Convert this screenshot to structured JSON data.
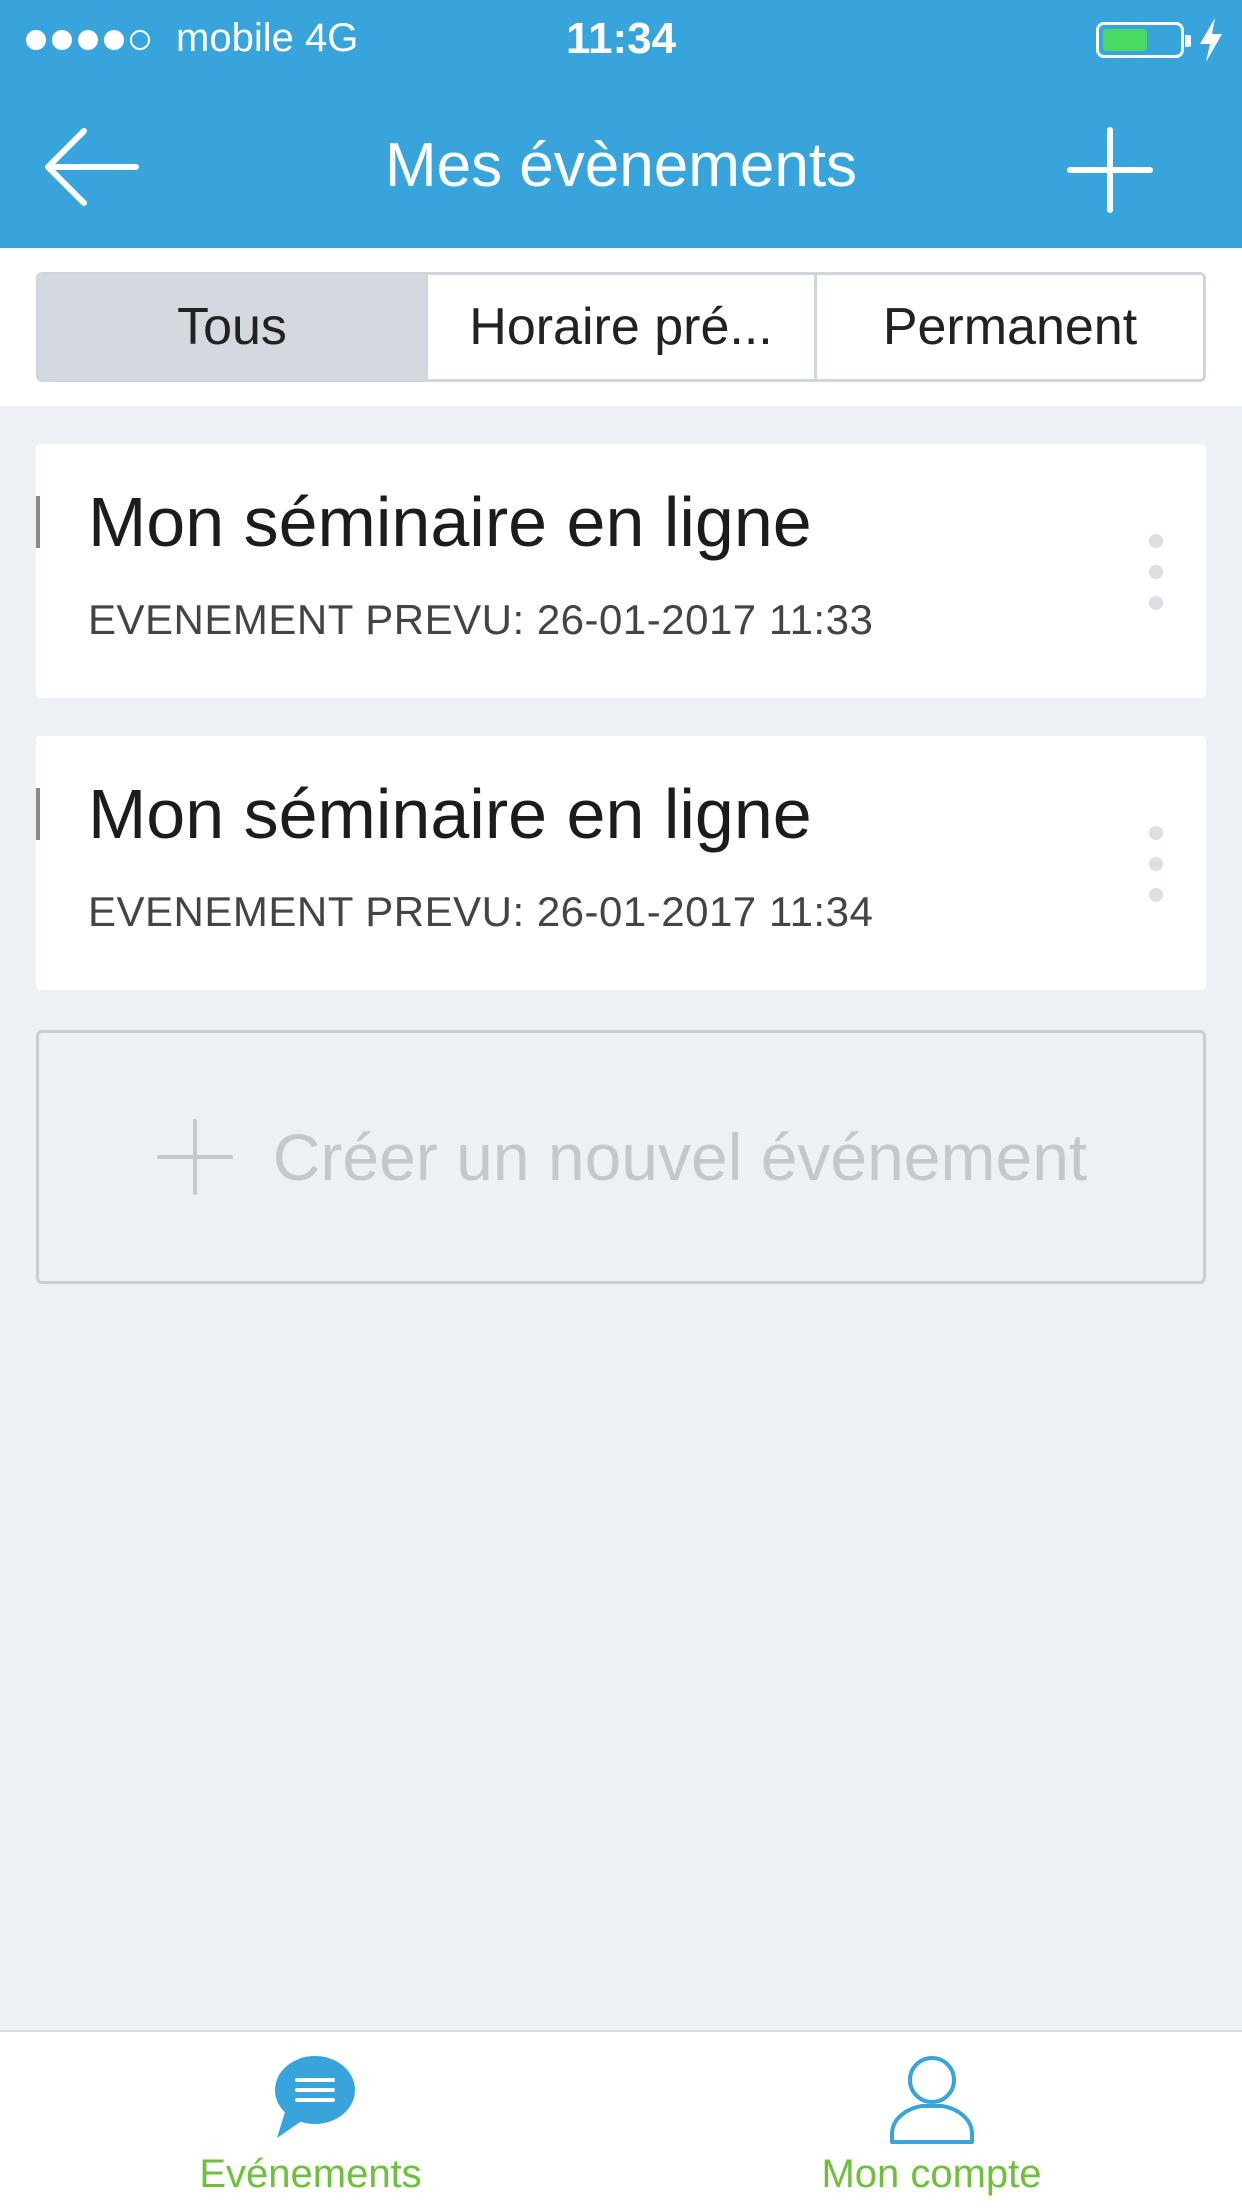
{
  "status_bar": {
    "carrier": "mobile 4G",
    "time": "11:34",
    "battery_level": 0.55,
    "battery_color": "#4cd964"
  },
  "nav": {
    "title": "Mes évènements",
    "back_icon": "arrow-left-icon",
    "add_icon": "plus-icon"
  },
  "filters": {
    "items": [
      {
        "label": "Tous",
        "active": true
      },
      {
        "label": "Horaire pré...",
        "active": false
      },
      {
        "label": "Permanent",
        "active": false
      }
    ]
  },
  "events": [
    {
      "title": "Mon séminaire en ligne",
      "subtitle": "EVENEMENT PREVU: 26-01-2017  11:33"
    },
    {
      "title": "Mon séminaire en ligne",
      "subtitle": "EVENEMENT PREVU: 26-01-2017  11:34"
    }
  ],
  "create": {
    "label": "Créer un nouvel événement"
  },
  "tabbar": {
    "items": [
      {
        "label": "Evénements",
        "icon": "chat-bubble-icon",
        "active": true
      },
      {
        "label": "Mon compte",
        "icon": "user-icon",
        "active": false
      }
    ]
  },
  "colors": {
    "header": "#38a4dc",
    "accent_green": "#6ec03a",
    "background": "#edf0f5"
  }
}
